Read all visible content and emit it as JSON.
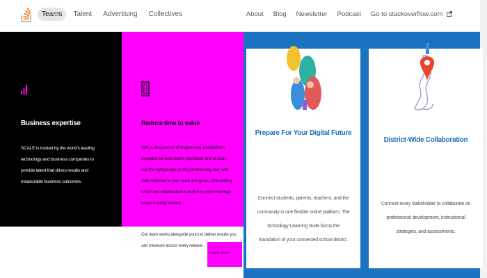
{
  "nav": {
    "left": [
      "Teams",
      "Talent",
      "Advertising",
      "Collectives"
    ],
    "active_index": 0,
    "right": [
      "About",
      "Blog",
      "Newsletter",
      "Podcast",
      "Go to stackoverflow.com"
    ]
  },
  "panels": {
    "black": {
      "title": "Business expertise",
      "body": "SCALE is trusted by the world's leading technology and business companies to provide talent that drives results and measurable business outcomes."
    },
    "magenta": {
      "title": "Reduce time to value",
      "body": "With a deep bench of engineering and platform expertise we help teams ship faster and at scale. Get the right people on the job from day one, with skills matched to your stack and goals. Onboarding is fast and collaboration is built in so your roadmap keeps moving forward.",
      "tail": "Our team works alongside yours to deliver results you can measure across every release.",
      "chip": "Learn more"
    }
  },
  "cards": [
    {
      "title": "Prepare For Your Digital Future",
      "body": "Connect students, parents, teachers, and the community in one flexible online platform. The Schoology Learning Suite forms the foundation of your connected school district."
    },
    {
      "title": "District-Wide Collaboration",
      "body": "Connect every stakeholder to collaborate on professional development, instructional strategies, and assessments."
    }
  ],
  "colors": {
    "black_panel": "#000000",
    "magenta_panel": "#ff00ff",
    "blue_background": "#1b72c0",
    "card_title": "#1d6fb8",
    "so_orange": "#f48024"
  },
  "icons": {
    "logo": "stackoverflow-logo",
    "external": "external-link-icon",
    "black_panel_icon": "bar-chart-icon",
    "magenta_panel_icon": "bracket-icon",
    "card_1_illustration": "people-illustration",
    "card_2_illustration": "map-pin-illustration"
  }
}
